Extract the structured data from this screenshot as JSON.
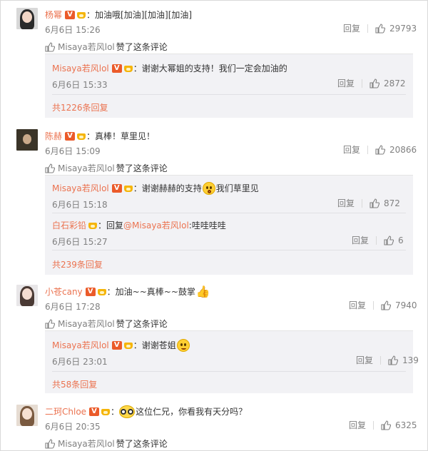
{
  "reply_label": "回复",
  "liked_suffix": "赞了这条评论",
  "comments": [
    {
      "user": "杨幂",
      "text": "：加油哦[加油][加油][加油]",
      "time": "6月6日 15:26",
      "likes": "29793",
      "liked_by": "Misaya若风lol",
      "replies": [
        {
          "user": "Misaya若风lol",
          "text": "：谢谢大幂姐的支持！我们一定会加油的",
          "time": "6月6日 15:33",
          "likes": "2872"
        }
      ],
      "more": "共1226条回复"
    },
    {
      "user": "陈赫",
      "text": "：真棒！草里见！",
      "time": "6月6日 15:09",
      "likes": "20866",
      "liked_by": "Misaya若风lol",
      "replies": [
        {
          "user": "Misaya若风lol",
          "text": "：谢谢赫赫的支持",
          "text2": "我们草里见",
          "time": "6月6日 15:18",
          "likes": "872"
        },
        {
          "user": "白石彩铅",
          "text": "：回复",
          "mention": "@Misaya若风lol",
          "text2": ":哇哇哇哇",
          "time": "6月6日 15:27",
          "likes": "6"
        }
      ],
      "more": "共239条回复"
    },
    {
      "user": "小苍cany",
      "text": "：加油~~真棒~~鼓掌",
      "time": "6月6日 17:28",
      "likes": "7940",
      "liked_by": "Misaya若风lol",
      "replies": [
        {
          "user": "Misaya若风lol",
          "text": "：谢谢苍姐",
          "time": "6月6日 23:01",
          "likes": "139"
        }
      ],
      "more": "共58条回复"
    },
    {
      "user": "二珂Chloe",
      "text": "这位仁兄，你看我有天分吗？",
      "time": "6月6日 20:35",
      "likes": "6325",
      "liked_by": "Misaya若风lol",
      "prefix": "："
    }
  ],
  "colors": {
    "accent": "#eb7350",
    "muted": "#808080",
    "subbox_bg": "#f2f2f5"
  },
  "icons": [
    "v-badge-icon",
    "vip-crown-icon",
    "thumbs-up-icon",
    "emoji-icon"
  ]
}
